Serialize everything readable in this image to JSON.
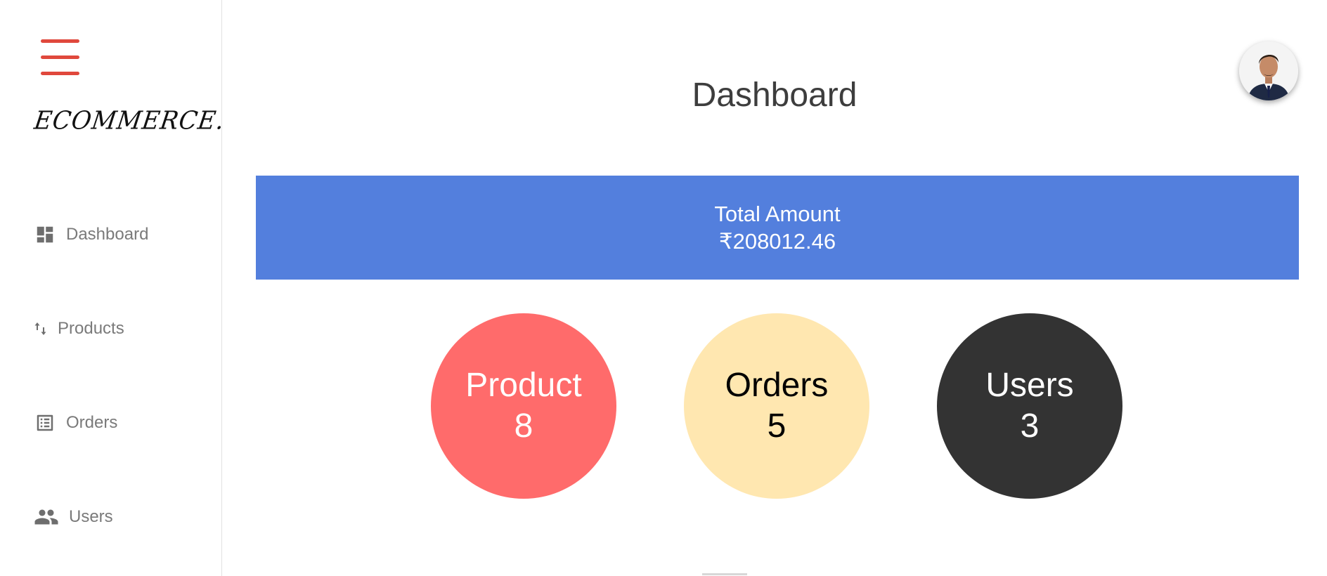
{
  "brand": {
    "logo_text": "ECOMMERCE.",
    "menu_icon": "hamburger-icon",
    "menu_color": "#e0483c"
  },
  "sidebar": {
    "items": [
      {
        "label": "Dashboard",
        "icon": "dashboard-icon"
      },
      {
        "label": "Products",
        "icon": "sort-arrows-icon"
      },
      {
        "label": "Orders",
        "icon": "list-alt-icon"
      },
      {
        "label": "Users",
        "icon": "people-icon"
      }
    ]
  },
  "header": {
    "title": "Dashboard",
    "avatar": "user-avatar"
  },
  "summary": {
    "total_label": "Total Amount",
    "total_value": "₹208012.46",
    "color": "#537fdd"
  },
  "stats": [
    {
      "label": "Product",
      "value": "8",
      "color": "#ff6b6b"
    },
    {
      "label": "Orders",
      "value": "5",
      "color": "#ffe7b0"
    },
    {
      "label": "Users",
      "value": "3",
      "color": "#333333"
    }
  ]
}
